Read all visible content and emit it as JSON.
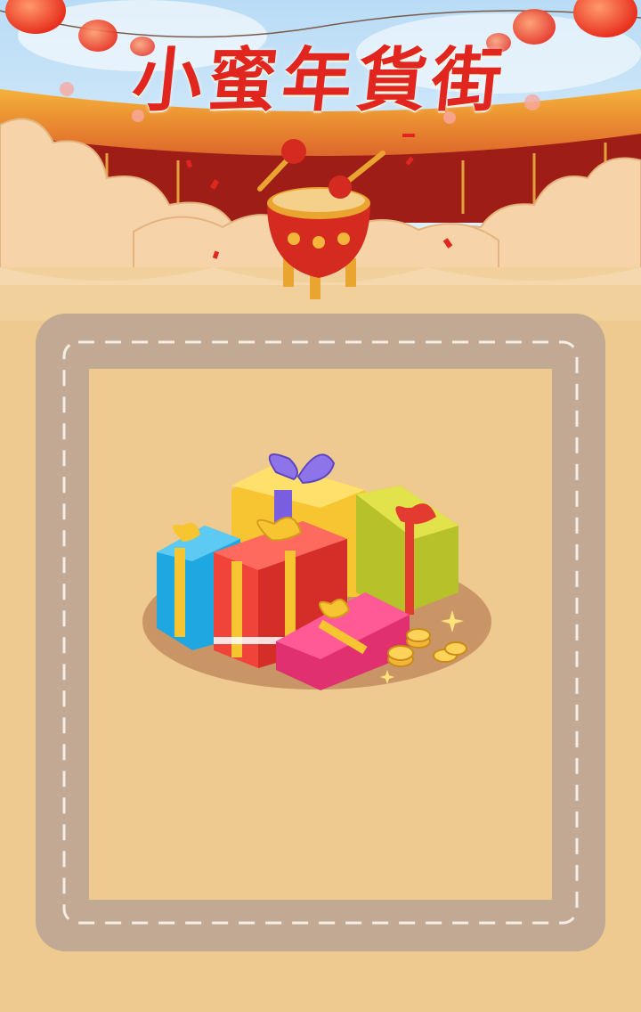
{
  "game": {
    "title": "小蜜年貨街"
  },
  "colors": {
    "background": "#eeca90",
    "track": "#c2a994",
    "board_fill": "#eeca90",
    "title_red": "#e0261f",
    "sky": "#cfe6f8",
    "palace_red": "#c8251c",
    "cloud": "#f6d3a8",
    "gift_shadow": "#c99566"
  },
  "icons": {
    "drum": "drum-icon",
    "drumsticks": "drumstick-icon",
    "lanterns": "lantern-icon",
    "gift_pile": "gift-pile-icon",
    "coins": "coin-stack-icon"
  }
}
